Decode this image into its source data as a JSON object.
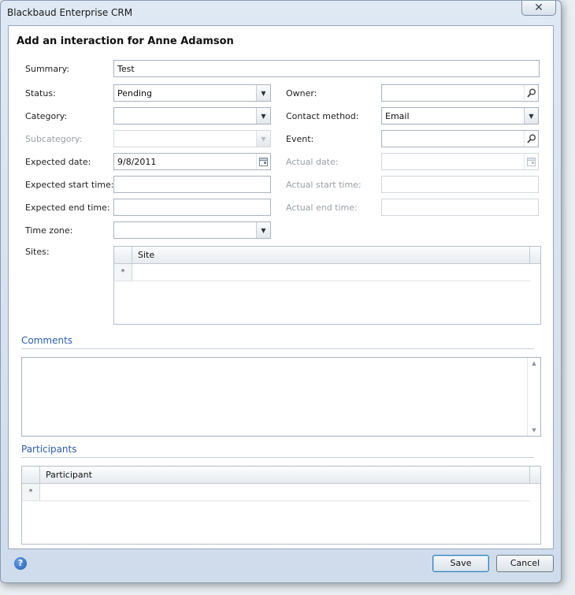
{
  "window": {
    "title": "Blackbaud Enterprise CRM",
    "close_glyph": "✕"
  },
  "form": {
    "heading": "Add an interaction for Anne Adamson",
    "summary": {
      "label": "Summary:",
      "value": "Test"
    },
    "status": {
      "label": "Status:",
      "value": "Pending"
    },
    "category": {
      "label": "Category:",
      "value": ""
    },
    "subcategory": {
      "label": "Subcategory:",
      "value": ""
    },
    "expected_date": {
      "label": "Expected date:",
      "value": "9/8/2011"
    },
    "expected_start_time": {
      "label": "Expected start time:",
      "value": ""
    },
    "expected_end_time": {
      "label": "Expected end time:",
      "value": ""
    },
    "time_zone": {
      "label": "Time zone:",
      "value": ""
    },
    "sites": {
      "label": "Sites:",
      "column": "Site",
      "new_row_marker": "*"
    },
    "owner": {
      "label": "Owner:",
      "value": ""
    },
    "contact_method": {
      "label": "Contact method:",
      "value": "Email"
    },
    "event": {
      "label": "Event:",
      "value": ""
    },
    "actual_date": {
      "label": "Actual date:",
      "value": ""
    },
    "actual_start_time": {
      "label": "Actual start time:",
      "value": ""
    },
    "actual_end_time": {
      "label": "Actual end time:",
      "value": ""
    }
  },
  "comments": {
    "title": "Comments",
    "value": ""
  },
  "participants": {
    "title": "Participants",
    "column": "Participant",
    "new_row_marker": "*"
  },
  "footer": {
    "help_glyph": "?",
    "save_label": "Save",
    "cancel_label": "Cancel"
  }
}
